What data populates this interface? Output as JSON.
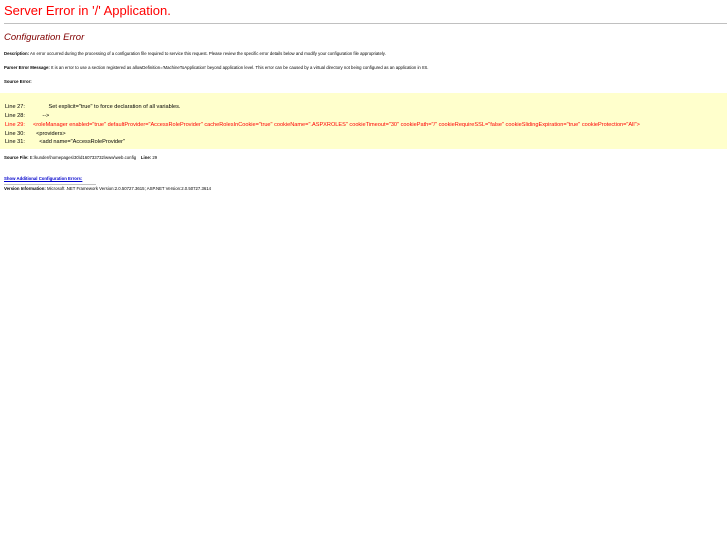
{
  "page": {
    "server_title": "Server Error in '/' Application.",
    "error_heading": "Configuration Error",
    "description_label": "Description:",
    "description_text": " An error occurred during the processing of a configuration file required to service this request. Please review the specific error details below and modify your configuration file appropriately.",
    "parser_label": "Parser Error Message:",
    "parser_text": " It is an error to use a section registered as allowDefinition='MachineToApplication' beyond application level.  This error can be caused by a virtual directory not being configured as an application in IIS.",
    "source_label": "Source Error:",
    "file_label": "Source File:",
    "file_text": " E:\\kunden\\homepages\\30\\d160733732\\www\\web.config",
    "line_label": "Line:",
    "line_text": " 29",
    "show_link": "Show Additional Configuration Errors:",
    "version_label": "Version Information:",
    "version_text": " Microsoft .NET Framework Version:2.0.50727.3615; ASP.NET Version:2.0.50727.3614"
  },
  "source_code": {
    "lines": [
      {
        "number": "Line 27:",
        "text": "          Set explicit=\"true\" to force declaration of all variables."
      },
      {
        "number": "Line 28:",
        "text": "      -->"
      },
      {
        "number": "Line 29:",
        "text": "<roleManager enabled=\"true\" defaultProvider=\"AccessRoleProvider\" cacheRolesInCookie=\"true\" cookieName=\".ASPXROLES\" cookieTimeout=\"30\" cookiePath=\"/\" cookieRequireSSL=\"false\" cookieSlidingExpiration=\"true\" cookieProtection=\"All\">"
      },
      {
        "number": "Line 30:",
        "text": "  <providers>"
      },
      {
        "number": "Line 31:",
        "text": "    <add name=\"AccessRoleProvider\""
      }
    ]
  },
  "colors": {
    "title": "#ff0000",
    "heading": "#800000",
    "code_background": "#ffffcc",
    "error_line": "#ff0000",
    "link": "#0000cc"
  }
}
